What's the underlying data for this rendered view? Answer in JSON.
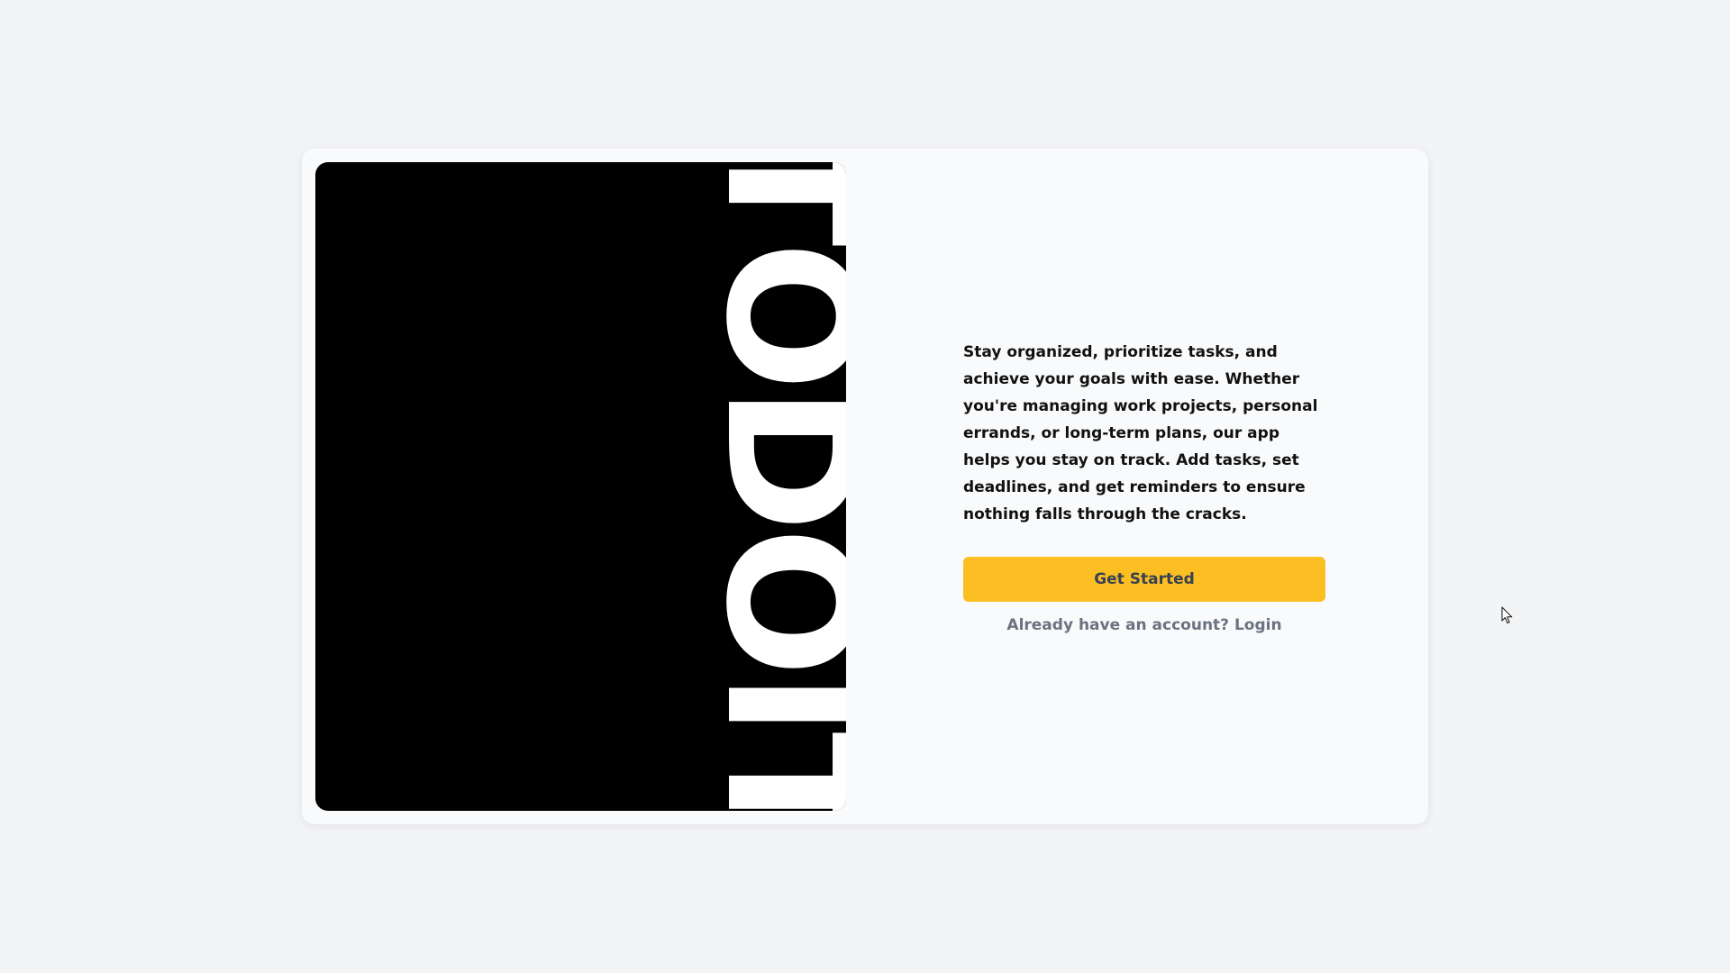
{
  "hero": {
    "wordmark": "TODOIT"
  },
  "content": {
    "description": "Stay organized, prioritize tasks, and achieve your goals with ease. Whether you're managing work projects, personal errands, or long-term plans, our app helps you stay on track. Add tasks, set deadlines, and get reminders to ensure nothing falls through the cracks.",
    "cta_label": "Get Started",
    "login_prompt": "Already have an account?",
    "login_label": "Login"
  },
  "colors": {
    "page_background": "#f3f4f6",
    "card_background": "#f9fafb",
    "hero_background": "#000000",
    "hero_text": "#ffffff",
    "accent": "#fbbf24",
    "button_text": "#374151",
    "muted_text": "#6b7280"
  },
  "icons": {
    "cursor": "mouse-pointer-icon"
  }
}
